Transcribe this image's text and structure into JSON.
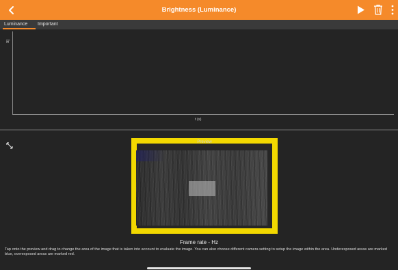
{
  "header": {
    "title": "Brightness (Luminance)",
    "back_icon": "chevron-left-icon",
    "play_icon": "play-icon",
    "trash_icon": "trash-icon",
    "menu_icon": "more-vertical-icon",
    "bar_color": "#f58a2a"
  },
  "tabs": [
    {
      "label": "Luminance",
      "active": true
    },
    {
      "label": "Important",
      "active": false
    }
  ],
  "graph": {
    "y_label": "lx",
    "x_label": "t (s)"
  },
  "preview": {
    "label": "Preview",
    "frame_color": "#f2d800",
    "expand_icon": "expand-icon"
  },
  "status": {
    "frame_rate": "Frame rate  - Hz"
  },
  "help": {
    "text": "Tap onto the preview and drag to change the area of the image that is taken into account to evaluate the image. You can also choose different camera setting to setup the image within the area. Underexposed areas are marked blue, overexposed areas are marked red."
  }
}
